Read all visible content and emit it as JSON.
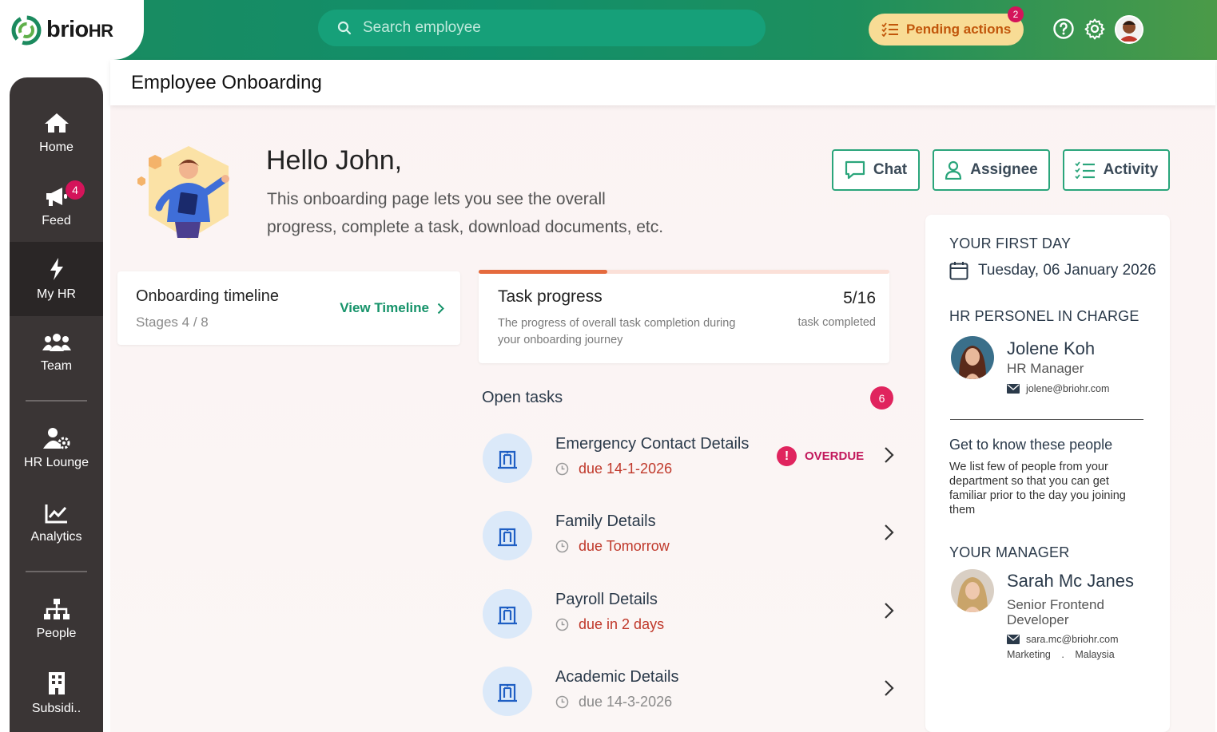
{
  "brand": {
    "name": "brio",
    "suffix": "HR",
    "colors": {
      "primary": "#1b8a5e",
      "accent": "#e56a3d",
      "alert": "#e0245e"
    }
  },
  "search": {
    "placeholder": "Search employee"
  },
  "topbar": {
    "pending_label": "Pending actions",
    "pending_count": "2"
  },
  "sidebar": {
    "items": [
      {
        "label": "Home",
        "icon": "home-icon"
      },
      {
        "label": "Feed",
        "icon": "megaphone-icon",
        "badge": "4"
      },
      {
        "label": "My HR",
        "icon": "bolt-icon",
        "active": true
      },
      {
        "label": "Team",
        "icon": "team-icon"
      },
      {
        "label": "HR Lounge",
        "icon": "user-gear-icon"
      },
      {
        "label": "Analytics",
        "icon": "chart-icon"
      },
      {
        "label": "People",
        "icon": "org-chart-icon"
      },
      {
        "label": "Subsidi..",
        "icon": "building-icon"
      }
    ]
  },
  "page": {
    "title": "Employee Onboarding"
  },
  "welcome": {
    "greeting": "Hello John,",
    "line1": "This onboarding page lets you see the overall",
    "line2": "progress, complete a task, download documents, etc."
  },
  "actions": {
    "chat": "Chat",
    "assignee": "Assignee",
    "activity": "Activity"
  },
  "timeline": {
    "title": "Onboarding timeline",
    "stages": "Stages 4 / 8",
    "link": "View Timeline"
  },
  "progress": {
    "title": "Task progress",
    "description": "The progress of overall task completion during your onboarding journey",
    "count": "5/16",
    "count_label": "task completed",
    "fraction": 0.3125
  },
  "open_tasks": {
    "title": "Open tasks",
    "count": "6",
    "tasks": [
      {
        "title": "Emergency Contact Details",
        "due": "due 14-1-2026",
        "status": "OVERDUE"
      },
      {
        "title": "Family Details",
        "due": "due Tomorrow"
      },
      {
        "title": "Payroll Details",
        "due": "due in 2 days"
      },
      {
        "title": "Academic Details",
        "due": "due 14-3-2026"
      }
    ]
  },
  "right_panel": {
    "first_day_label": "YOUR FIRST DAY",
    "first_day_date": "Tuesday, 06 January 2026",
    "hr_label": "HR PERSONEL IN CHARGE",
    "hr": {
      "name": "Jolene Koh",
      "role": "HR Manager",
      "email": "jolene@briohr.com"
    },
    "gtk_title": "Get to know these people",
    "gtk_desc": "We list few of people from your department so that you can get familiar prior to the day you joining them",
    "manager_label": "YOUR MANAGER",
    "manager": {
      "name": "Sarah Mc Janes",
      "role": "Senior Frontend Developer",
      "email": "sara.mc@briohr.com",
      "department": "Marketing",
      "sep": ".",
      "country": "Malaysia"
    }
  }
}
